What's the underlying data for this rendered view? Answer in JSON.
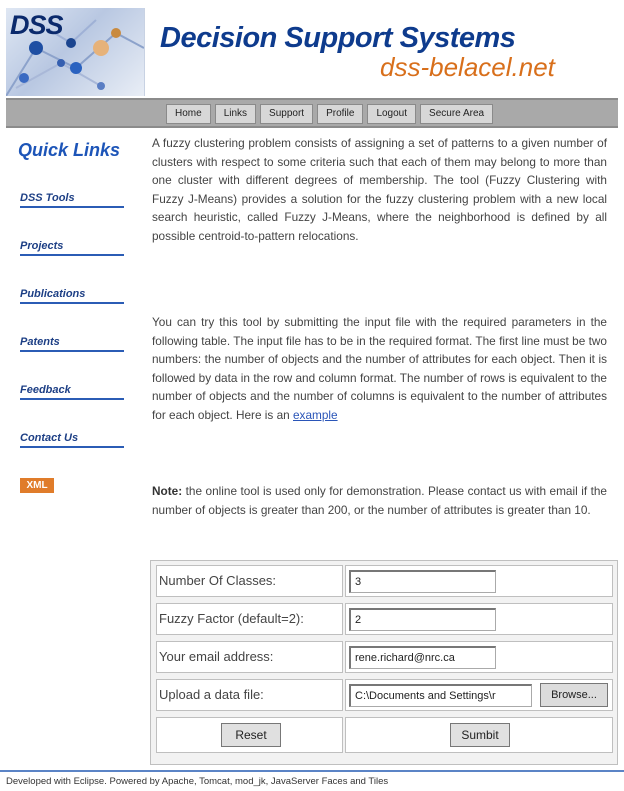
{
  "header": {
    "logo_text": "DSS",
    "title": "Decision Support Systems",
    "site": "dss-belacel.net"
  },
  "nav": {
    "items": [
      "Home",
      "Links",
      "Support",
      "Profile",
      "Logout",
      "Secure Area"
    ]
  },
  "sidebar": {
    "heading": "Quick Links",
    "links": [
      "DSS Tools",
      "Projects",
      "Publications",
      "Patents",
      "Feedback",
      "Contact Us"
    ],
    "xml_badge": "XML"
  },
  "content": {
    "para1": "A fuzzy clustering problem consists of assigning a set of patterns to a given number of clusters with respect to some criteria such that each of them may belong to more than one cluster with different degrees of membership. The tool (Fuzzy Clustering with Fuzzy J-Means) provides a solution for the fuzzy clustering problem with a new local search heuristic, called Fuzzy J-Means, where the neighborhood is defined by all possible centroid-to-pattern relocations.",
    "para2": "You can try this tool by submitting the input file with the required parameters in the following table. The input file has to be in the required format. The first line must be two numbers: the number of objects and the number of attributes for each object. Then it is followed by data in the row and column format. The number of rows is equivalent to the number of objects and the number of columns is equivalent to the number of attributes for each object. Here is an",
    "example_link": "example",
    "note_label": "Note:",
    "note_text": " the online tool is used only for demonstration. Please contact us with email if the number of objects is greater than 200, or the number of attributes is greater than 10."
  },
  "form": {
    "classes_label": "Number Of Classes:",
    "classes_value": "3",
    "fuzzy_label": "Fuzzy Factor (default=2):",
    "fuzzy_value": "2",
    "email_label": "Your email address:",
    "email_value": "rene.richard@nrc.ca",
    "upload_label": "Upload a data file:",
    "upload_value": "C:\\Documents and Settings\\r",
    "browse_label": "Browse...",
    "reset_label": "Reset",
    "submit_label": "Sumbit"
  },
  "footer": {
    "text": "Developed with Eclipse. Powered by Apache, Tomcat, mod_jk, JavaServer Faces and Tiles"
  },
  "colors": {
    "title_blue": "#0e3b8d",
    "site_orange": "#d86f1b",
    "link_blue": "#1d3f85",
    "nav_gray": "#a9a9a9"
  }
}
